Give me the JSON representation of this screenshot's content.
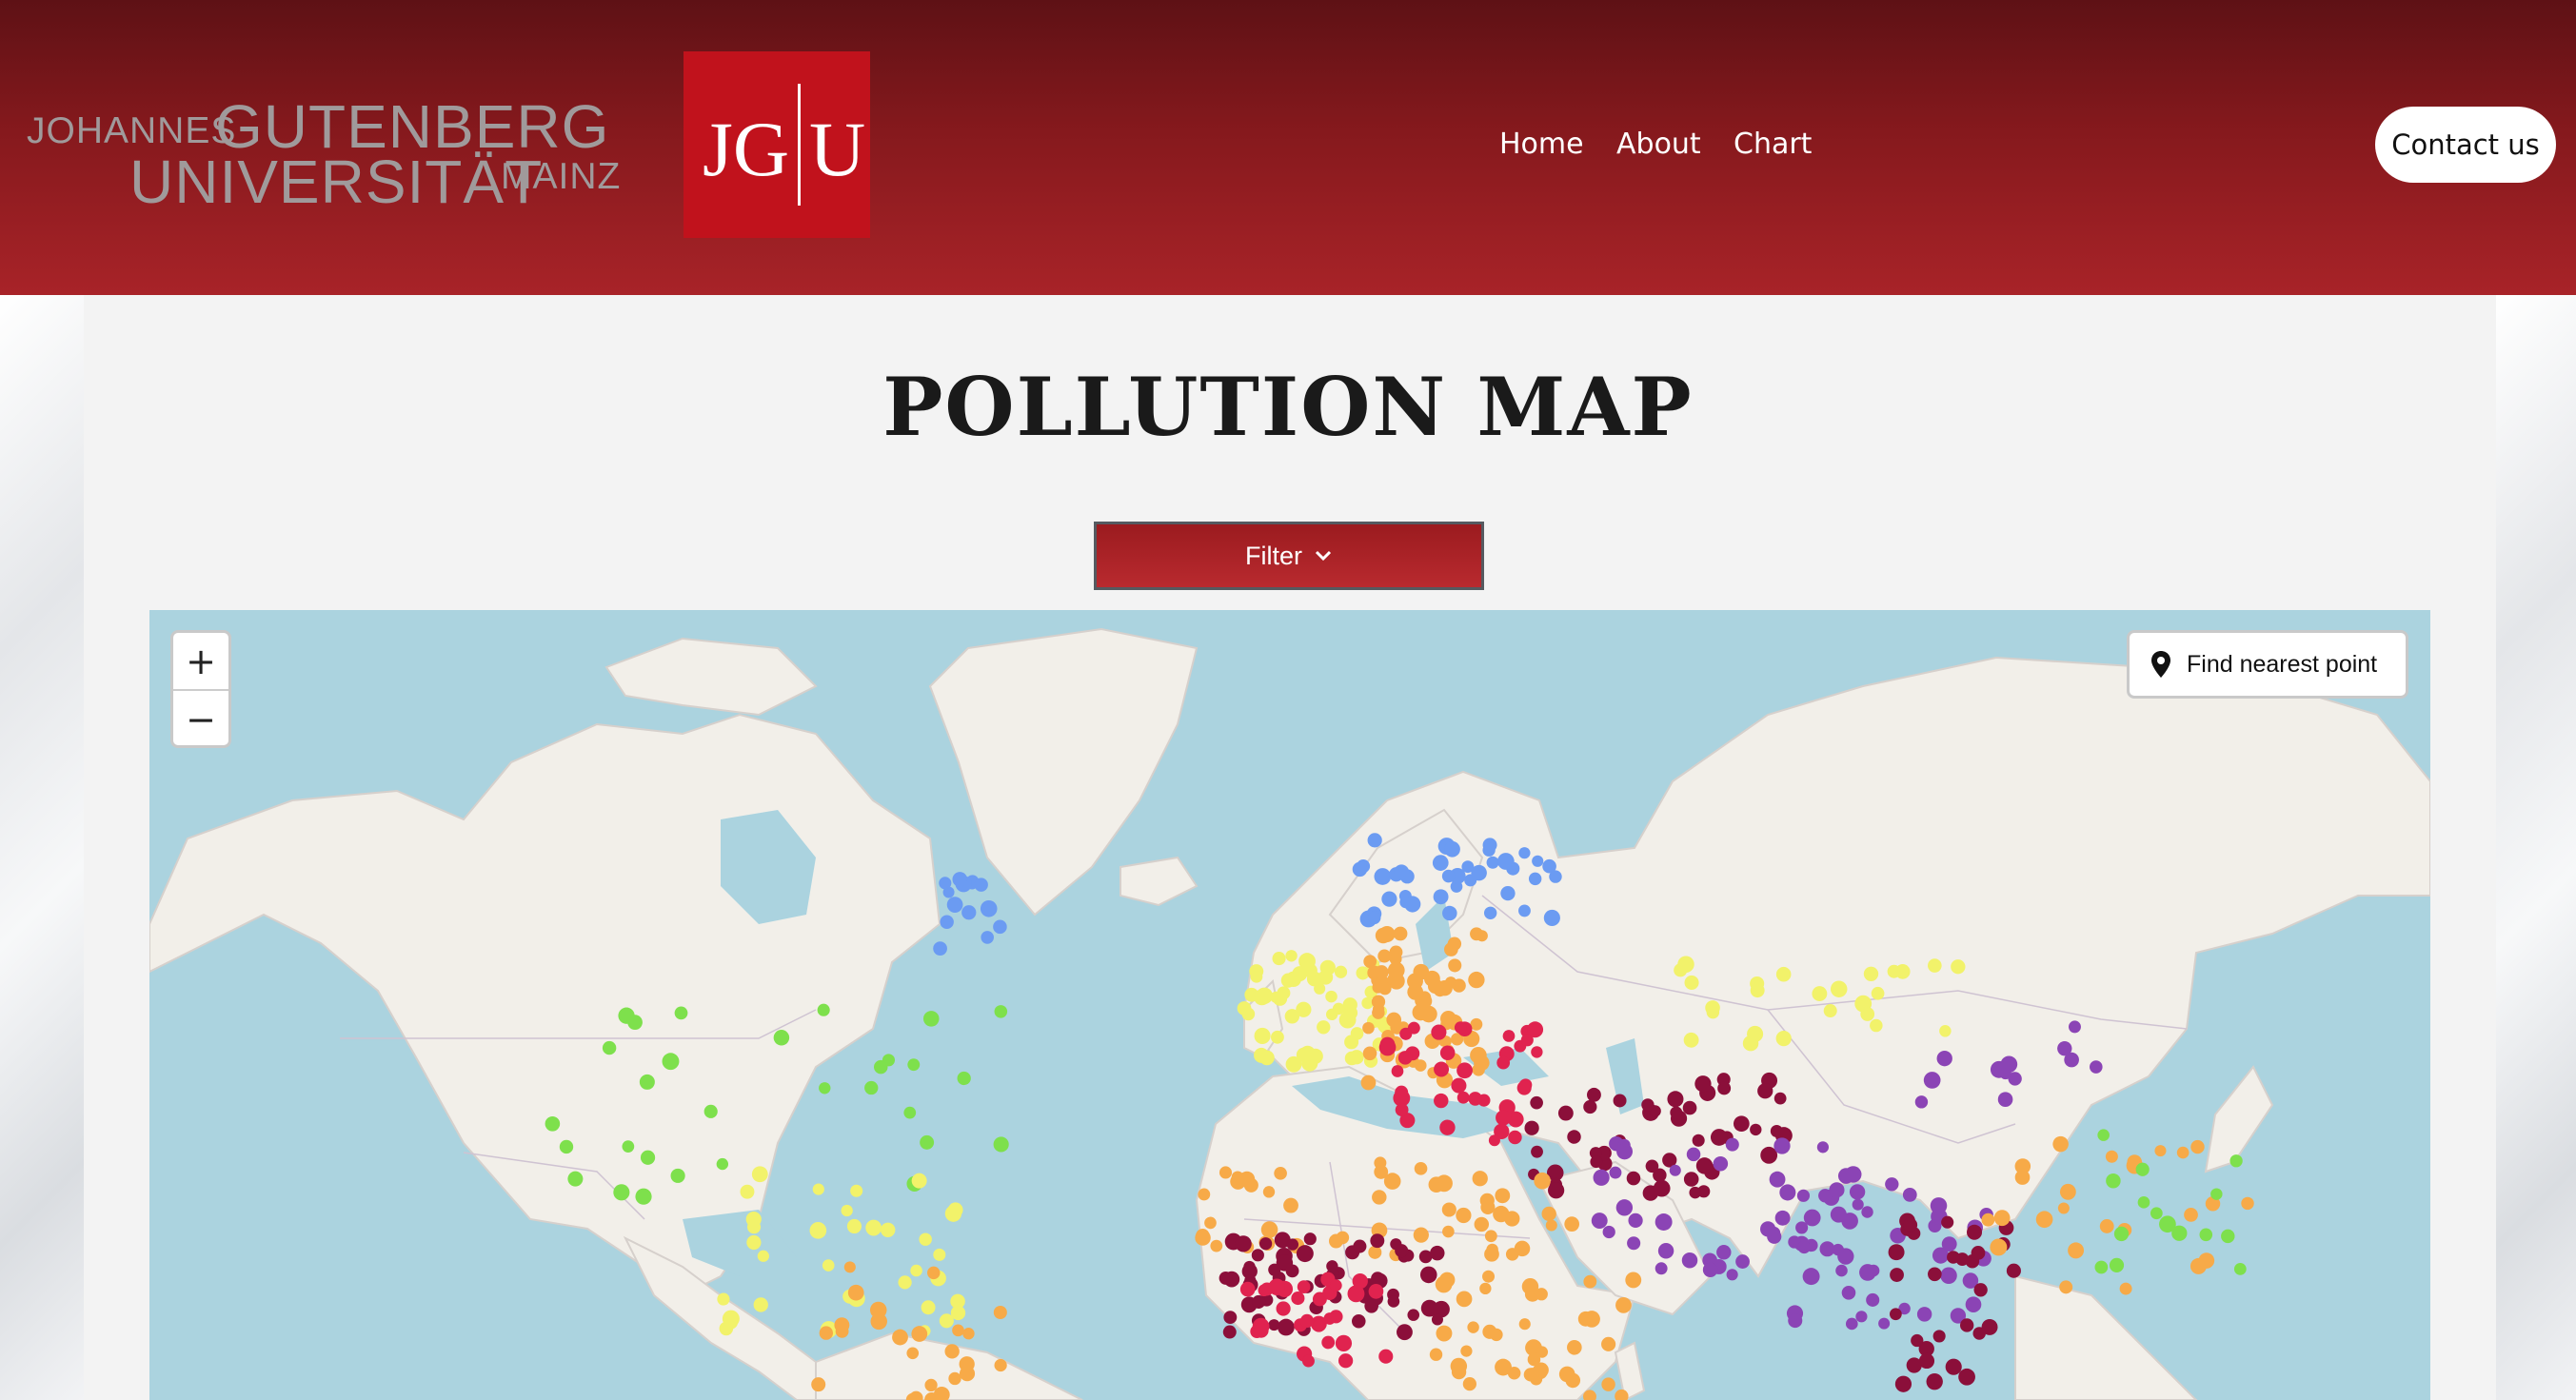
{
  "header": {
    "logo_text": [
      "JOHANNES",
      "GUTENBERG",
      "UNIVERSITÄT",
      "MAINZ"
    ],
    "logo_badge": [
      "JG",
      "U"
    ],
    "nav": [
      "Home",
      "About",
      "Chart"
    ],
    "contact_label": "Contact us"
  },
  "page": {
    "title": "POLLUTION MAP"
  },
  "filter": {
    "label": "Filter"
  },
  "map": {
    "zoom_in_label": "+",
    "zoom_out_label": "−",
    "nearest_label": "Find nearest point",
    "markers": {
      "legend_colors": {
        "good": "#6b9bf2",
        "moderate": "#7ee04c",
        "sensitive": "#f2f26a",
        "unhealthy": "#f7aa48",
        "very_unhealthy": "#e0234f",
        "hazardous": "#8b44b5",
        "extreme": "#8b0f3a"
      }
    }
  }
}
